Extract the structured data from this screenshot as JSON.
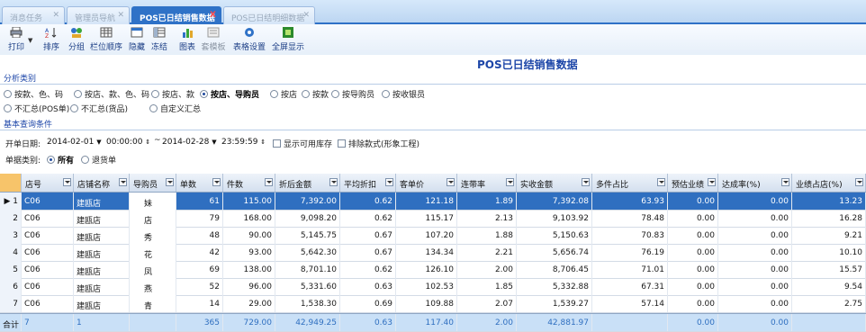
{
  "tabs": [
    {
      "label": "消息任务",
      "active": false
    },
    {
      "label": "管理员导航",
      "active": false
    },
    {
      "label": "POS已日结销售数据",
      "active": true
    },
    {
      "label": "POS已日结明细数据",
      "active": false
    }
  ],
  "toolbar": {
    "print": "打印",
    "sort": "排序",
    "group": "分组",
    "column_order": "栏位顺序",
    "hide": "隐藏",
    "freeze": "冻结",
    "chart": "图表",
    "template": "套模板",
    "table_settings": "表格设置",
    "fullscreen": "全屏显示"
  },
  "report_title": "POS已日结销售数据",
  "analysis": {
    "section_title": "分析类别",
    "options_row1": [
      "按款、色、码",
      "按店、款、色、码",
      "按店、款",
      "按店、导购员",
      "按店",
      "按款",
      "按导购员",
      "按收银员"
    ],
    "selected": "按店、导购员",
    "options_row2": [
      "不汇总(POS单)",
      "不汇总(货品)",
      "自定义汇总"
    ]
  },
  "query": {
    "section_title": "基本查询条件",
    "open_date_label": "开单日期:",
    "date_from": "2014-02-01",
    "time_from": "00:00:00",
    "tilde": "~",
    "date_to": "2014-02-28",
    "time_to": "23:59:59",
    "show_stock": "显示可用库存",
    "exclude_style": "排除款式(形象工程)",
    "doc_type_label": "单据类别:",
    "doc_all": "所有",
    "doc_return": "退货单"
  },
  "grid": {
    "columns": [
      "店号",
      "店铺名称",
      "导购员",
      "单数",
      "件数",
      "折后金额",
      "平均折扣",
      "客单价",
      "连带率",
      "实收金额",
      "多件占比",
      "预估业绩",
      "达成率(%)",
      "业绩占店(%)"
    ],
    "rows": [
      [
        "C06",
        "建瓯店",
        "妹",
        "61",
        "115.00",
        "7,392.00",
        "0.62",
        "121.18",
        "1.89",
        "7,392.08",
        "63.93",
        "0.00",
        "0.00",
        "13.23"
      ],
      [
        "C06",
        "建瓯店",
        "店",
        "79",
        "168.00",
        "9,098.20",
        "0.62",
        "115.17",
        "2.13",
        "9,103.92",
        "78.48",
        "0.00",
        "0.00",
        "16.28"
      ],
      [
        "C06",
        "建瓯店",
        "秀",
        "48",
        "90.00",
        "5,145.75",
        "0.67",
        "107.20",
        "1.88",
        "5,150.63",
        "70.83",
        "0.00",
        "0.00",
        "9.21"
      ],
      [
        "C06",
        "建瓯店",
        "花",
        "42",
        "93.00",
        "5,642.30",
        "0.67",
        "134.34",
        "2.21",
        "5,656.74",
        "76.19",
        "0.00",
        "0.00",
        "10.10"
      ],
      [
        "C06",
        "建瓯店",
        "凤",
        "69",
        "138.00",
        "8,701.10",
        "0.62",
        "126.10",
        "2.00",
        "8,706.45",
        "71.01",
        "0.00",
        "0.00",
        "15.57"
      ],
      [
        "C06",
        "建瓯店",
        "燕",
        "52",
        "96.00",
        "5,331.60",
        "0.63",
        "102.53",
        "1.85",
        "5,332.88",
        "67.31",
        "0.00",
        "0.00",
        "9.54"
      ],
      [
        "C06",
        "建瓯店",
        "青",
        "14",
        "29.00",
        "1,538.30",
        "0.69",
        "109.88",
        "2.07",
        "1,539.27",
        "57.14",
        "0.00",
        "0.00",
        "2.75"
      ]
    ],
    "total_label": "合计",
    "totals": [
      "7",
      "1",
      "",
      "365",
      "729.00",
      "42,949.25",
      "0.63",
      "117.40",
      "2.00",
      "42,881.97",
      "",
      "0.00",
      "0.00",
      ""
    ]
  }
}
